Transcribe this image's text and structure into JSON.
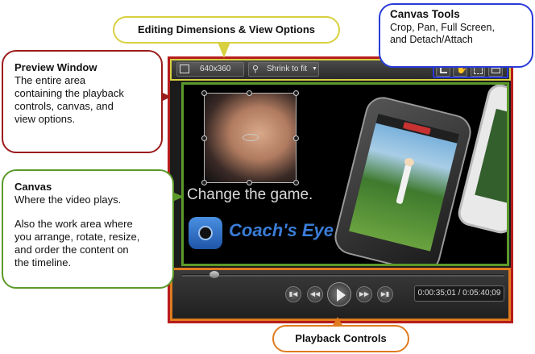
{
  "callouts": {
    "editing": "Editing Dimensions & View Options",
    "tools_title": "Canvas Tools",
    "tools_body_1": "Crop, Pan, Full Screen,",
    "tools_body_2": "and Detach/Attach",
    "preview_title": "Preview Window",
    "preview_body_1": "The entire area",
    "preview_body_2": "containing the playback",
    "preview_body_3": "controls, canvas, and",
    "preview_body_4": "view options.",
    "canvas_title": "Canvas",
    "canvas_body_1": "Where the video plays.",
    "canvas_body_2": "Also the work area where",
    "canvas_body_3": "you arrange, rotate, resize,",
    "canvas_body_4": "and order the content on",
    "canvas_body_5": "the timeline.",
    "playback": "Playback Controls"
  },
  "toolbar": {
    "dimensions": "640x360",
    "zoom_label": "Shrink to fit"
  },
  "canvas": {
    "slogan": "Change the game.",
    "brand": "Coach's Eye"
  },
  "playback": {
    "timecode": "0:00:35;01 / 0:05:40;09",
    "progress": 0.1
  },
  "colors": {
    "preview": "#b71c1c",
    "canvas": "#5b9a2a",
    "editing": "#d8d040",
    "tools": "#2a3bd8",
    "playback": "#e07b1e"
  }
}
